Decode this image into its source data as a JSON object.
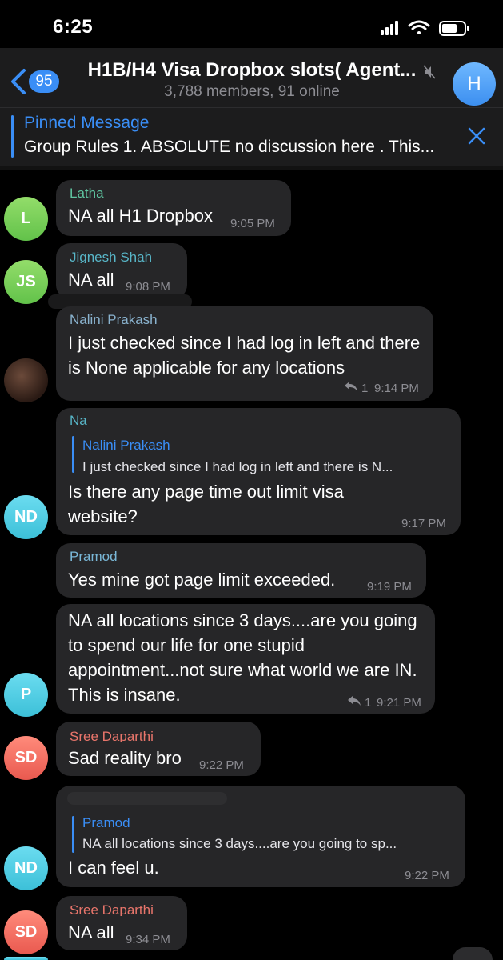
{
  "status_bar": {
    "time": "6:25"
  },
  "header": {
    "unread_count": "95",
    "title": "H1B/H4 Visa Dropbox slots( Agent...",
    "subtitle": "3,788 members, 91 online",
    "avatar_letter": "H"
  },
  "pinned": {
    "title": "Pinned Message",
    "text": "Group Rules  1. ABSOLUTE no discussion here . This..."
  },
  "messages": [
    {
      "sender": "Latha",
      "text": "NA all H1 Dropbox",
      "time": "9:05 PM",
      "avatar": "L"
    },
    {
      "sender": "Jignesh Shah",
      "text": "NA all",
      "time": "9:08 PM",
      "avatar": "JS"
    },
    {
      "sender": "Nalini Prakash",
      "text": "I just checked since I had log in left and there is None applicable for any locations",
      "time": "9:14 PM",
      "replies": "1"
    },
    {
      "sender": "Na",
      "reply_name": "Nalini Prakash",
      "reply_text": "I just checked since I had log in left and there is N...",
      "text": "Is there any page time out limit visa website?",
      "time": "9:17 PM",
      "avatar": "ND"
    },
    {
      "sender": "Pramod",
      "text": "Yes mine got page limit exceeded.",
      "time": "9:19 PM"
    },
    {
      "text": "NA all locations since 3 days....are you going to spend our life for one stupid appointment...not sure what world we are IN. This is insane.",
      "time": "9:21 PM",
      "replies": "1",
      "avatar": "P"
    },
    {
      "sender": "Sree Daparthi",
      "text": "Sad reality bro",
      "time": "9:22 PM",
      "avatar": "SD"
    },
    {
      "reply_name": "Pramod",
      "reply_text": "NA all locations since 3 days....are you going to sp...",
      "text": "I can feel u.",
      "time": "9:22 PM",
      "avatar": "ND"
    },
    {
      "sender": "Sree Daparthi",
      "text": "NA all",
      "time": "9:34 PM",
      "avatar": "SD"
    }
  ],
  "colors": {
    "accent": "#3a8ef6",
    "bubble": "#262628",
    "background": "#000000",
    "sender_latha": "#5fc4a0",
    "sender_jignesh": "#58b6c8",
    "sender_nalini": "#8ab3cf",
    "sender_pramod": "#7ab8d8",
    "sender_sree": "#e8756b"
  },
  "icons": [
    "back-chevron-icon",
    "mute-icon",
    "close-icon",
    "reply-icon",
    "cellular-signal-icon",
    "wifi-icon",
    "battery-icon"
  ]
}
